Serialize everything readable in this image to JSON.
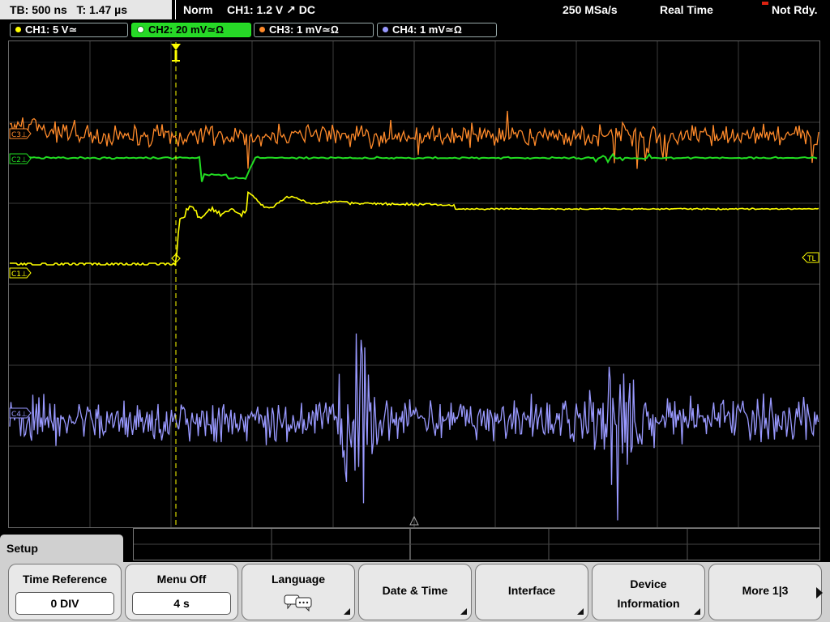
{
  "topbar": {
    "timebase": "TB: 500 ns",
    "trigger_time": "T: 1.47 µs",
    "trigger_mode": "Norm",
    "trigger_source": "CH1: 1.2 V ↗ DC",
    "sample_rate": "250 MSa/s",
    "acq_mode": "Real Time",
    "status": "Not Rdy."
  },
  "channels": [
    {
      "label": "CH1: 5 V≃",
      "color": "#ffff00",
      "active": false
    },
    {
      "label": "CH2: 20 mV≃Ω",
      "color": "#22dd22",
      "active": true
    },
    {
      "label": "CH3: 1 mV≃Ω",
      "color": "#ff8a2a",
      "active": false
    },
    {
      "label": "CH4: 1 mV≃Ω",
      "color": "#9999ff",
      "active": false
    }
  ],
  "markers": {
    "c3": "C3⊥",
    "c2": "C2⊥",
    "c1": "C1⊥",
    "c4": "C4⊥",
    "tl": "TL"
  },
  "menu": {
    "title": "Setup",
    "softkeys": [
      {
        "label": "Time Reference",
        "value": "0 DIV"
      },
      {
        "label": "Menu Off",
        "value": "4 s"
      },
      {
        "label": "Language",
        "icon": "speech-bubbles-icon"
      },
      {
        "label": "Date & Time"
      },
      {
        "label": "Interface"
      },
      {
        "label_line1": "Device",
        "label_line2": "Information"
      },
      {
        "label": "More 1|3"
      }
    ]
  },
  "colors": {
    "ch1": "#ffff00",
    "ch2": "#22dd22",
    "ch3": "#ff8a2a",
    "ch4": "#9999ff",
    "grid": "#5a5a5a",
    "trigger": "#ffff00"
  }
}
